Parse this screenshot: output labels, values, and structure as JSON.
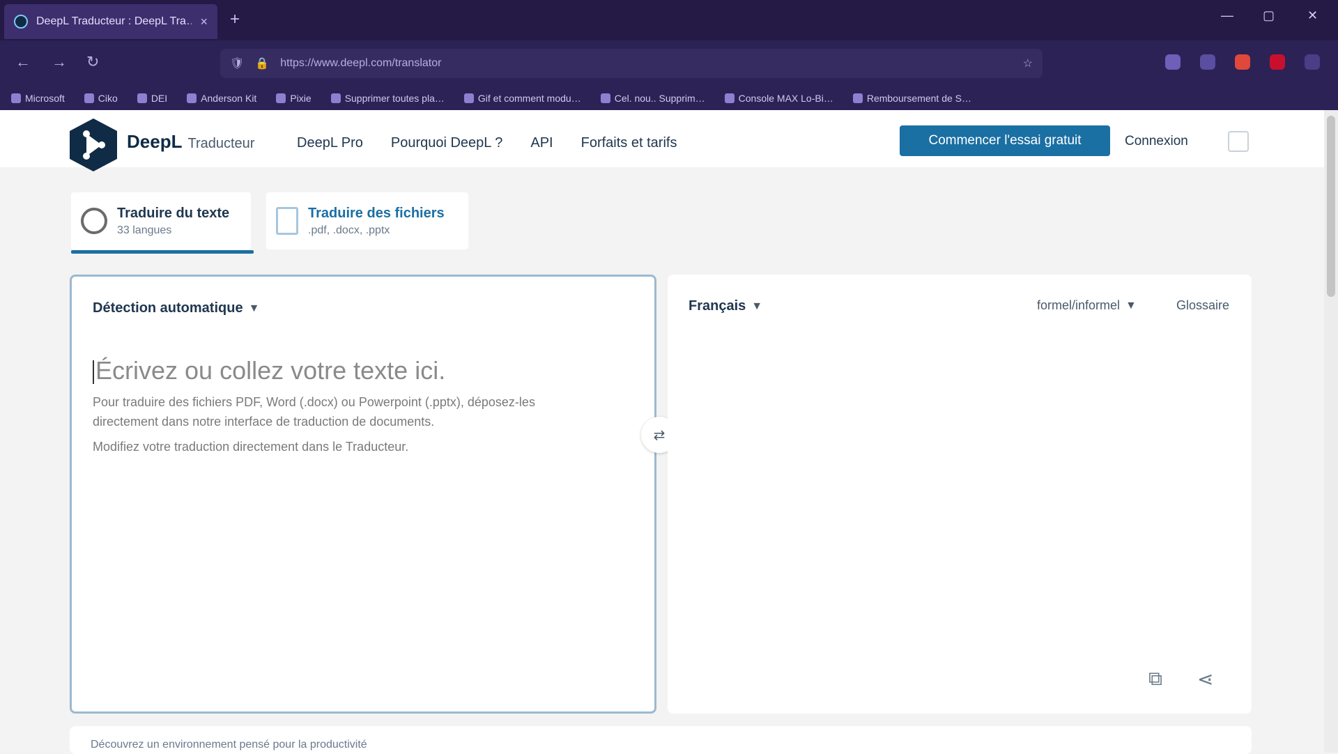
{
  "browser": {
    "tab_title": "DeepL Traducteur : DeepL Tra…",
    "tab_close": "×",
    "new_tab": "+",
    "address": "https://www.deepl.com/translator",
    "address_host": "deepl.com",
    "nav_back": "←",
    "nav_forward": "→",
    "nav_reload": "↻",
    "window_controls": {
      "minimize": "—",
      "maximize": "▢",
      "close": "✕"
    },
    "bookmarks": [
      "Microsoft",
      "Ciko",
      "DEI",
      "Anderson Kit",
      "Pixie",
      "Supprimer toutes pla…",
      "Gif et comment modu…",
      "Cel. nou.. Supprim…",
      "Console MAX Lo-Bi…",
      "Remboursement de S…"
    ]
  },
  "header": {
    "brand": "DeepL",
    "brand_sub": "Traducteur",
    "nav": [
      "DeepL Pro",
      "Pourquoi DeepL ?",
      "API",
      "Forfaits et tarifs"
    ],
    "cta": "Commencer l'essai gratuit",
    "login": "Connexion"
  },
  "mode_tabs": [
    {
      "title": "Traduire du texte",
      "subtitle": "33 langues"
    },
    {
      "title": "Traduire des fichiers",
      "subtitle": ".pdf, .docx, .pptx"
    }
  ],
  "source": {
    "language": "Détection automatique",
    "placeholder": "Écrivez ou collez votre texte ici.",
    "hint1": "Pour traduire des fichiers PDF, Word (.docx) ou Powerpoint (.pptx), déposez-les directement dans notre interface de traduction de documents.",
    "hint2": "Modifiez votre traduction directement dans le Traducteur."
  },
  "target": {
    "language": "Français",
    "formality": "formel/informel",
    "glossary": "Glossaire"
  },
  "bottom": {
    "text": "Découvrez un environnement pensé pour la productivité"
  }
}
